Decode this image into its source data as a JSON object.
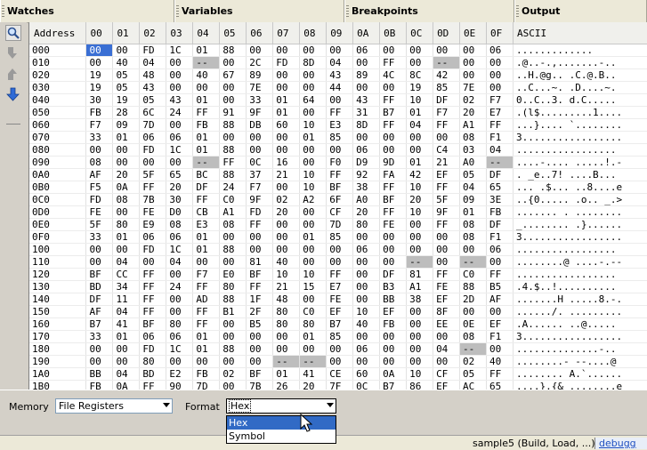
{
  "tabs": [
    "Watches",
    "Variables",
    "Breakpoints",
    "Output"
  ],
  "columns": [
    "Address",
    "00",
    "01",
    "02",
    "03",
    "04",
    "05",
    "06",
    "07",
    "08",
    "09",
    "0A",
    "0B",
    "0C",
    "0D",
    "0E",
    "0F",
    "ASCII"
  ],
  "rows": [
    {
      "addr": "000",
      "cells": [
        "00",
        "00",
        "FD",
        "1C",
        "01",
        "88",
        "00",
        "00",
        "00",
        "00",
        "06",
        "00",
        "00",
        "00",
        "00",
        "06"
      ],
      "ascii": "............."
    },
    {
      "addr": "010",
      "cells": [
        "00",
        "40",
        "04",
        "00",
        "--",
        "00",
        "2C",
        "FD",
        "8D",
        "04",
        "00",
        "FF",
        "00",
        "--",
        "00",
        "00"
      ],
      "ascii": ".@..-.,.......-.."
    },
    {
      "addr": "020",
      "cells": [
        "19",
        "05",
        "48",
        "00",
        "40",
        "67",
        "89",
        "00",
        "00",
        "43",
        "89",
        "4C",
        "8C",
        "42",
        "00",
        "00"
      ],
      "ascii": "..H.@g.. .C.@.B.."
    },
    {
      "addr": "030",
      "cells": [
        "19",
        "05",
        "43",
        "00",
        "00",
        "00",
        "7E",
        "00",
        "00",
        "44",
        "00",
        "00",
        "19",
        "85",
        "7E",
        "00"
      ],
      "ascii": "..C...~. .D....~."
    },
    {
      "addr": "040",
      "cells": [
        "30",
        "19",
        "05",
        "43",
        "01",
        "00",
        "33",
        "01",
        "64",
        "00",
        "43",
        "FF",
        "10",
        "DF",
        "02",
        "F7"
      ],
      "ascii": "0..C..3. d.C....."
    },
    {
      "addr": "050",
      "cells": [
        "FB",
        "28",
        "6C",
        "24",
        "FF",
        "91",
        "9F",
        "01",
        "00",
        "FF",
        "31",
        "B7",
        "01",
        "F7",
        "20",
        "E7"
      ],
      "ascii": ".(l$.........1...."
    },
    {
      "addr": "060",
      "cells": [
        "F7",
        "09",
        "7D",
        "00",
        "FB",
        "88",
        "DB",
        "60",
        "10",
        "E3",
        "8D",
        "FF",
        "04",
        "FF",
        "A1",
        "FF"
      ],
      "ascii": "...}.... `........"
    },
    {
      "addr": "070",
      "cells": [
        "33",
        "01",
        "06",
        "06",
        "01",
        "00",
        "00",
        "00",
        "01",
        "85",
        "00",
        "00",
        "00",
        "00",
        "08",
        "F1"
      ],
      "ascii": "3................."
    },
    {
      "addr": "080",
      "cells": [
        "00",
        "00",
        "FD",
        "1C",
        "01",
        "88",
        "00",
        "00",
        "00",
        "00",
        "06",
        "00",
        "00",
        "C4",
        "03",
        "04"
      ],
      "ascii": "................."
    },
    {
      "addr": "090",
      "cells": [
        "08",
        "00",
        "00",
        "00",
        "--",
        "FF",
        "0C",
        "16",
        "00",
        "F0",
        "D9",
        "9D",
        "01",
        "21",
        "A0",
        "--"
      ],
      "ascii": "....-.... .....!.-"
    },
    {
      "addr": "0A0",
      "cells": [
        "AF",
        "20",
        "5F",
        "65",
        "BC",
        "88",
        "37",
        "21",
        "10",
        "FF",
        "92",
        "FA",
        "42",
        "EF",
        "05",
        "DF"
      ],
      "ascii": ". _e..7! ....B..."
    },
    {
      "addr": "0B0",
      "cells": [
        "F5",
        "0A",
        "FF",
        "20",
        "DF",
        "24",
        "F7",
        "00",
        "10",
        "BF",
        "38",
        "FF",
        "10",
        "FF",
        "04",
        "65"
      ],
      "ascii": "... .$... ..8....e"
    },
    {
      "addr": "0C0",
      "cells": [
        "FD",
        "08",
        "7B",
        "30",
        "FF",
        "C0",
        "9F",
        "02",
        "A2",
        "6F",
        "A0",
        "BF",
        "20",
        "5F",
        "09",
        "3E"
      ],
      "ascii": "..{0..... .o.. _.>"
    },
    {
      "addr": "0D0",
      "cells": [
        "FE",
        "00",
        "FE",
        "D0",
        "CB",
        "A1",
        "FD",
        "20",
        "00",
        "CF",
        "20",
        "FF",
        "10",
        "9F",
        "01",
        "FB"
      ],
      "ascii": "....... . ........"
    },
    {
      "addr": "0E0",
      "cells": [
        "5F",
        "80",
        "E9",
        "08",
        "E3",
        "08",
        "FF",
        "00",
        "00",
        "7D",
        "80",
        "FE",
        "00",
        "FF",
        "08",
        "DF"
      ],
      "ascii": "_........ .}......"
    },
    {
      "addr": "0F0",
      "cells": [
        "33",
        "01",
        "06",
        "06",
        "01",
        "00",
        "00",
        "00",
        "01",
        "85",
        "00",
        "00",
        "00",
        "00",
        "08",
        "F1"
      ],
      "ascii": "3................."
    },
    {
      "addr": "100",
      "cells": [
        "00",
        "00",
        "FD",
        "1C",
        "01",
        "88",
        "00",
        "00",
        "00",
        "00",
        "06",
        "00",
        "00",
        "00",
        "00",
        "06"
      ],
      "ascii": "................."
    },
    {
      "addr": "110",
      "cells": [
        "00",
        "04",
        "00",
        "04",
        "00",
        "00",
        "81",
        "40",
        "00",
        "00",
        "00",
        "00",
        "--",
        "00",
        "--",
        "00"
      ],
      "ascii": "........@ ....-.--"
    },
    {
      "addr": "120",
      "cells": [
        "BF",
        "CC",
        "FF",
        "00",
        "F7",
        "E0",
        "BF",
        "10",
        "10",
        "FF",
        "00",
        "DF",
        "81",
        "FF",
        "C0",
        "FF"
      ],
      "ascii": "................."
    },
    {
      "addr": "130",
      "cells": [
        "BD",
        "34",
        "FF",
        "24",
        "FF",
        "80",
        "FF",
        "21",
        "15",
        "E7",
        "00",
        "B3",
        "A1",
        "FE",
        "88",
        "B5"
      ],
      "ascii": ".4.$..!.........."
    },
    {
      "addr": "140",
      "cells": [
        "DF",
        "11",
        "FF",
        "00",
        "AD",
        "88",
        "1F",
        "48",
        "00",
        "FE",
        "00",
        "BB",
        "38",
        "EF",
        "2D",
        "AF"
      ],
      "ascii": ".......H .....8.-."
    },
    {
      "addr": "150",
      "cells": [
        "AF",
        "04",
        "FF",
        "00",
        "FF",
        "B1",
        "2F",
        "80",
        "C0",
        "EF",
        "10",
        "EF",
        "00",
        "8F",
        "00",
        "00"
      ],
      "ascii": "....../. ........."
    },
    {
      "addr": "160",
      "cells": [
        "B7",
        "41",
        "BF",
        "80",
        "FF",
        "00",
        "B5",
        "80",
        "80",
        "B7",
        "40",
        "FB",
        "00",
        "EE",
        "0E",
        "EF"
      ],
      "ascii": ".A...... ..@....."
    },
    {
      "addr": "170",
      "cells": [
        "33",
        "01",
        "06",
        "06",
        "01",
        "00",
        "00",
        "00",
        "01",
        "85",
        "00",
        "00",
        "00",
        "00",
        "08",
        "F1"
      ],
      "ascii": "3................."
    },
    {
      "addr": "180",
      "cells": [
        "00",
        "00",
        "FD",
        "1C",
        "01",
        "88",
        "00",
        "00",
        "00",
        "00",
        "06",
        "00",
        "00",
        "04",
        "--",
        "00"
      ],
      "ascii": "..............-.."
    },
    {
      "addr": "190",
      "cells": [
        "00",
        "00",
        "80",
        "00",
        "00",
        "00",
        "00",
        "--",
        "--",
        "00",
        "00",
        "00",
        "00",
        "00",
        "02",
        "40"
      ],
      "ascii": "........- --....@"
    },
    {
      "addr": "1A0",
      "cells": [
        "BB",
        "04",
        "BD",
        "E2",
        "FB",
        "02",
        "BF",
        "01",
        "41",
        "CE",
        "60",
        "0A",
        "10",
        "CF",
        "05",
        "FF"
      ],
      "ascii": "........ A.`......"
    },
    {
      "addr": "1B0",
      "cells": [
        "FB",
        "0A",
        "FF",
        "90",
        "7D",
        "00",
        "7B",
        "26",
        "20",
        "7F",
        "0C",
        "B7",
        "86",
        "EF",
        "AC",
        "65"
      ],
      "ascii": "....}.{& ........e"
    }
  ],
  "bottom": {
    "memory_label": "Memory",
    "memory_value": "File Registers",
    "format_label": "Format",
    "format_value": "Hex",
    "format_options": [
      "Hex",
      "Symbol"
    ]
  },
  "status": {
    "text": "sample5 (Build, Load, ...)",
    "badge": "debugg"
  },
  "colors": {
    "selection": "#3a6fd4",
    "undefined_cell": "#bdbdbd",
    "dropdown_highlight": "#316ac5"
  }
}
